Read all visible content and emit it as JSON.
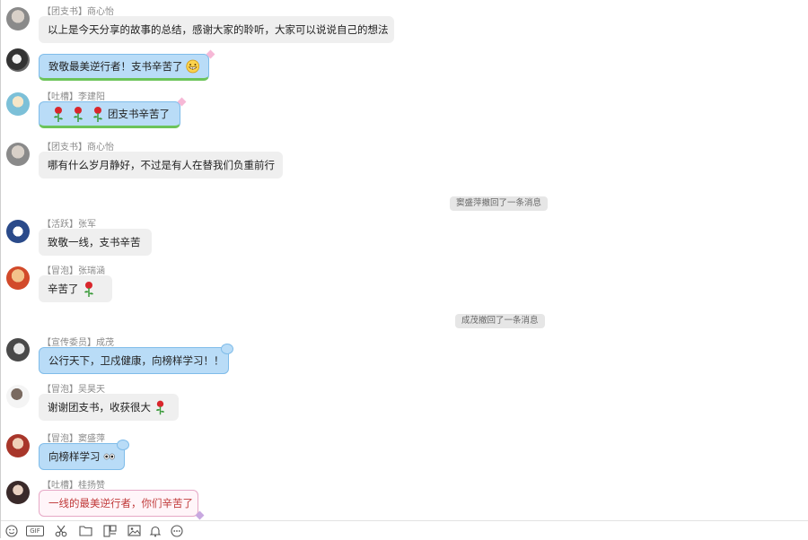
{
  "system_notices": [
    "窦盛萍撤回了一条消息",
    "成茂撤回了一条消息"
  ],
  "messages": [
    {
      "sender": "【团支书】商心怡",
      "text": "以上是今天分享的故事的总结，感谢大家的聆听，大家可以说说自己的想法"
    },
    {
      "sender": "",
      "text": "致敬最美逆行者！支书辛苦了"
    },
    {
      "sender": "【吐槽】李建阳",
      "text": "团支书辛苦了"
    },
    {
      "sender": "【团支书】商心怡",
      "text": "哪有什么岁月静好，不过是有人在替我们负重前行"
    },
    {
      "sender": "【活跃】张军",
      "text": "致敬一线，支书辛苦"
    },
    {
      "sender": "【冒泡】张瑞涵",
      "text": "辛苦了"
    },
    {
      "sender": "【宣传委员】成茂",
      "text": "公行天下，卫戍健康，向榜样学习！！"
    },
    {
      "sender": "【冒泡】吴昊天",
      "text": "谢谢团支书，收获很大"
    },
    {
      "sender": "【冒泡】窦盛萍",
      "text": "向榜样学习"
    },
    {
      "sender": "【吐槽】桂扬赞",
      "text": "一线的最美逆行者，你们辛苦了"
    }
  ],
  "toolbar": {
    "icons": [
      "smiley-icon",
      "gif-icon",
      "scissors-icon",
      "folder-icon",
      "screenshot-icon",
      "image-icon",
      "bell-icon",
      "more-icon"
    ],
    "gif_label": "GIF"
  },
  "colors": {
    "bubble_gray": "#efefef",
    "bubble_blue": "#b9dcf7",
    "bubble_border_blue": "#7fbce9",
    "bubble_pink_border": "#e6a8c6",
    "notice_bg": "#e6e6e6"
  }
}
